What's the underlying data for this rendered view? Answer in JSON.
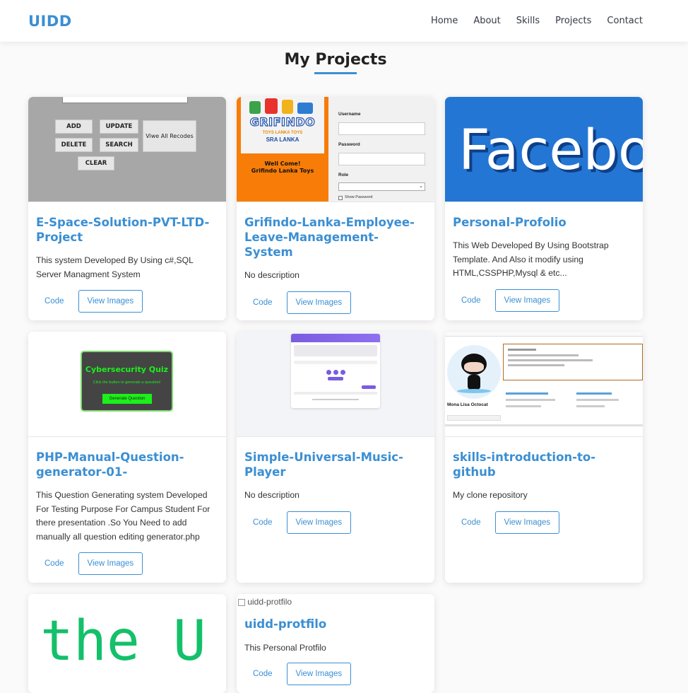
{
  "nav": {
    "logo": "UIDD",
    "items": [
      "Home",
      "About",
      "Skills",
      "Projects",
      "Contact"
    ]
  },
  "section_title": "My Projects",
  "colors": {
    "accent": "#3b8fd3",
    "facebook_blue": "#2476d4",
    "matrix_green": "#14c06a"
  },
  "projects": [
    {
      "title": "E-Space-Solution-PVT-LTD-Project",
      "desc": "This system Developed By Using c#,SQL Server Managment System",
      "code": "Code",
      "view": "View Images",
      "thumb": {
        "buttons": [
          "ADD",
          "UPDATE",
          "DELETE",
          "SEARCH",
          "CLEAR",
          "Viwe All Recodes"
        ]
      }
    },
    {
      "title": "Grifindo-Lanka-Employee-Leave-Management-System",
      "desc": "No description",
      "code": "Code",
      "view": "View Images",
      "thumb": {
        "logo": "GRIFINDO",
        "sub1": "TOYS LANKA TOYS",
        "sub2": "SRA LANKA",
        "welcome": "Well Come!",
        "company": "Grifindo Lanka Toys",
        "username": "Username",
        "password": "Password",
        "role": "Role",
        "show": "Show Password"
      }
    },
    {
      "title": "Personal-Profolio",
      "desc": "This Web Developed By Using Bootstrap Template. And Also it modify using HTML,CSSPHP,Mysql & etc...",
      "code": "Code",
      "view": "View Images",
      "thumb": {
        "text": "Facebo"
      }
    },
    {
      "title": "PHP-Manual-Question-generator-01-",
      "desc": "This Question Generating system Developed For Testing Purpose For Campus Student For there presentation .So You Need to add manually all question editing generator.php",
      "code": "Code",
      "view": "View Images",
      "thumb": {
        "quiz_title": "Cybersecurity Quiz",
        "quiz_sub": "Click the button to generate a question!",
        "quiz_btn": "Generate Question"
      }
    },
    {
      "title": "Simple-Universal-Music-Player",
      "desc": "No description",
      "code": "Code",
      "view": "View Images",
      "thumb": {}
    },
    {
      "title": "skills-introduction-to-github",
      "desc": "My clone repository",
      "code": "Code",
      "view": "View Images",
      "thumb": {
        "name": "Mona Lisa Octocat"
      }
    },
    {
      "title": "",
      "desc": "",
      "code": "",
      "view": "",
      "thumb": {
        "text": "the U"
      }
    },
    {
      "title": "uidd-protfilo",
      "desc": "This Personal Protfilo",
      "code": "Code",
      "view": "View Images",
      "thumb": {
        "alt": "uidd-protfilo"
      }
    }
  ]
}
